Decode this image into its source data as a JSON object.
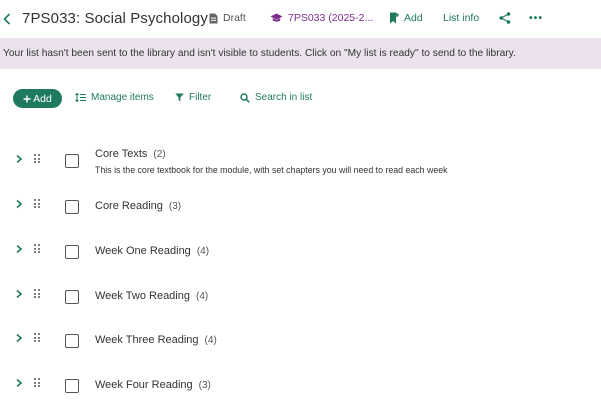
{
  "header": {
    "title": "7PS033: Social Psychology",
    "draft_label": "Draft",
    "module_label": "7PS033 (2025-2...",
    "add_label": "Add",
    "list_info_label": "List info",
    "more_label": "•••"
  },
  "banner": {
    "text": "Your list hasn't been sent to the library and isn't visible to students. Click on \"My list is ready\" to send to the library."
  },
  "actions": {
    "add_label": "Add",
    "manage_label": "Manage items",
    "filter_label": "Filter",
    "search_label": "Search in list"
  },
  "sections": [
    {
      "title": "Core Texts",
      "count": "(2)",
      "description": "This is the core textbook for the module, with set chapters you will need to read each week"
    },
    {
      "title": "Core Reading",
      "count": "(3)",
      "description": ""
    },
    {
      "title": "Week One Reading",
      "count": "(4)",
      "description": ""
    },
    {
      "title": "Week Two Reading",
      "count": "(4)",
      "description": ""
    },
    {
      "title": "Week Three Reading",
      "count": "(4)",
      "description": ""
    },
    {
      "title": "Week Four Reading",
      "count": "(3)",
      "description": ""
    }
  ],
  "colors": {
    "accent": "#1e7a5f",
    "module": "#7b2c8c",
    "banner": "#ece2ee"
  }
}
